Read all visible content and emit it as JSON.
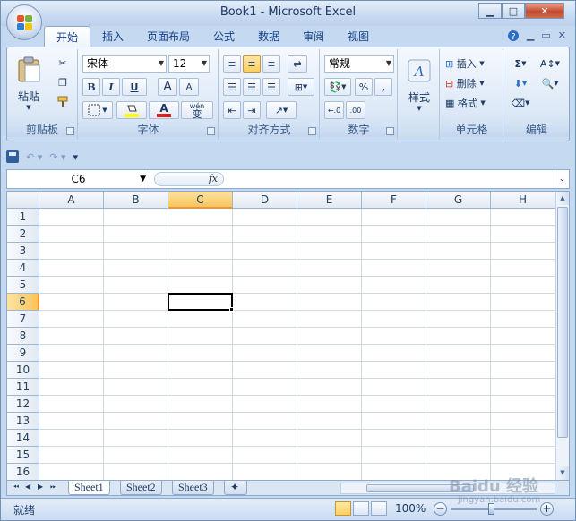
{
  "window": {
    "title": "Book1 - Microsoft Excel",
    "controls": {
      "minimize": "▁",
      "maximize": "□",
      "close": "✕"
    }
  },
  "ribbon_tabs": [
    "开始",
    "插入",
    "页面布局",
    "公式",
    "数据",
    "审阅",
    "视图"
  ],
  "active_tab": "开始",
  "ribbon": {
    "clipboard": {
      "label": "剪贴板",
      "paste": "粘贴"
    },
    "font": {
      "label": "字体",
      "font_name": "宋体",
      "font_size": "12",
      "bold": "B",
      "italic": "I",
      "underline": "U",
      "grow": "A",
      "shrink": "A",
      "phonetic": "wén",
      "phonetic_char": "变"
    },
    "alignment": {
      "label": "对齐方式"
    },
    "number": {
      "label": "数字",
      "format": "常规",
      "percent": "%",
      "comma": ","
    },
    "styles": {
      "label": "样式"
    },
    "cells": {
      "label": "单元格",
      "insert": "插入",
      "delete": "删除",
      "format": "格式"
    },
    "editing": {
      "label": "编辑"
    }
  },
  "formula_bar": {
    "name_box": "C6",
    "fx": "fx",
    "content": ""
  },
  "sheet": {
    "columns": [
      "A",
      "B",
      "C",
      "D",
      "E",
      "F",
      "G",
      "H"
    ],
    "rows": [
      "1",
      "2",
      "3",
      "4",
      "5",
      "6",
      "7",
      "8",
      "9",
      "10",
      "11",
      "12",
      "13",
      "14",
      "15",
      "16"
    ],
    "selected_column": "C",
    "selected_row": "6",
    "active_cell": "C6"
  },
  "sheet_tabs": [
    "Sheet1",
    "Sheet2",
    "Sheet3"
  ],
  "active_sheet": "Sheet1",
  "status": {
    "mode": "就绪",
    "zoom": "100%"
  },
  "watermark": {
    "text": "Baidu 经验",
    "sub": "jingyan.baidu.com"
  },
  "colors": {
    "accent": "#15428b",
    "selection": "#f9c45b",
    "ribbon_bg": "#dce8f6"
  }
}
